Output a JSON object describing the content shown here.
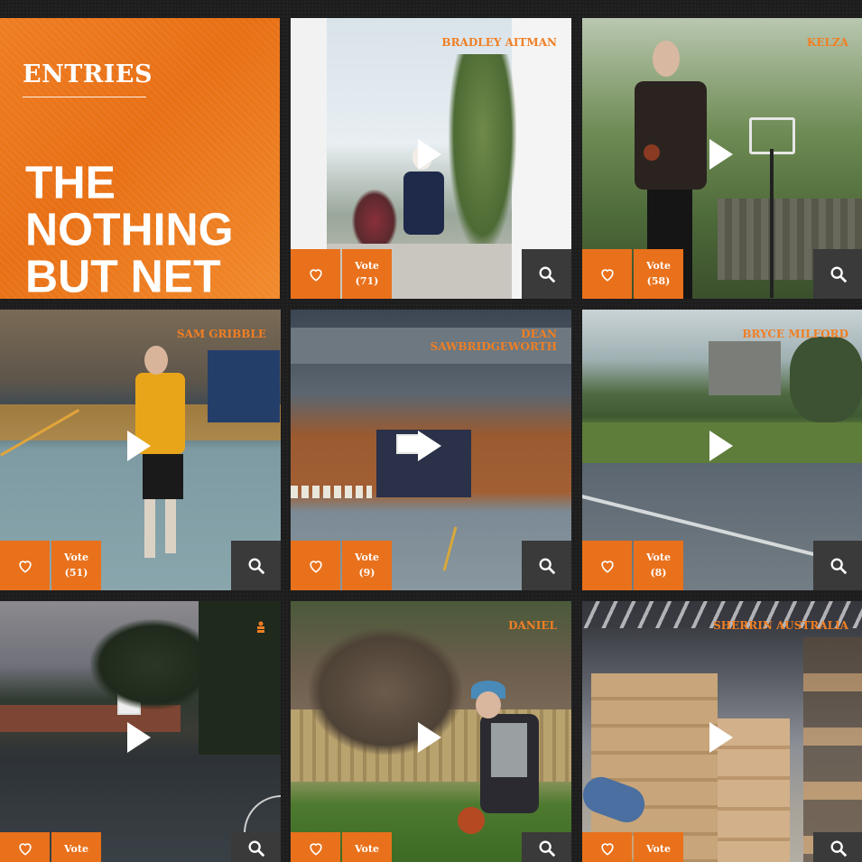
{
  "header": {
    "section_label": "ENTRIES",
    "title_lines": [
      "THE",
      "NOTHING",
      "BUT NET"
    ]
  },
  "vote_label": "Vote",
  "entries": [
    {
      "name": "BRADLEY AITMAN",
      "votes": "(71)"
    },
    {
      "name": "KELZA",
      "votes": "(58)"
    },
    {
      "name": "SAM GRIBBLE",
      "votes": "(51)"
    },
    {
      "name": "DEAN SAWBRIDGEWORTH",
      "votes": "(9)"
    },
    {
      "name": "BRYCE MILFORD",
      "votes": "(8)"
    },
    {
      "name": "",
      "votes": "",
      "icon": "person-icon"
    },
    {
      "name": "DANIEL",
      "votes": ""
    },
    {
      "name": "SHERRIN AUSTRALIA",
      "votes": ""
    }
  ],
  "colors": {
    "accent": "#e9711b",
    "dark_button": "#3a3a3a",
    "background": "#1d1d1d"
  }
}
